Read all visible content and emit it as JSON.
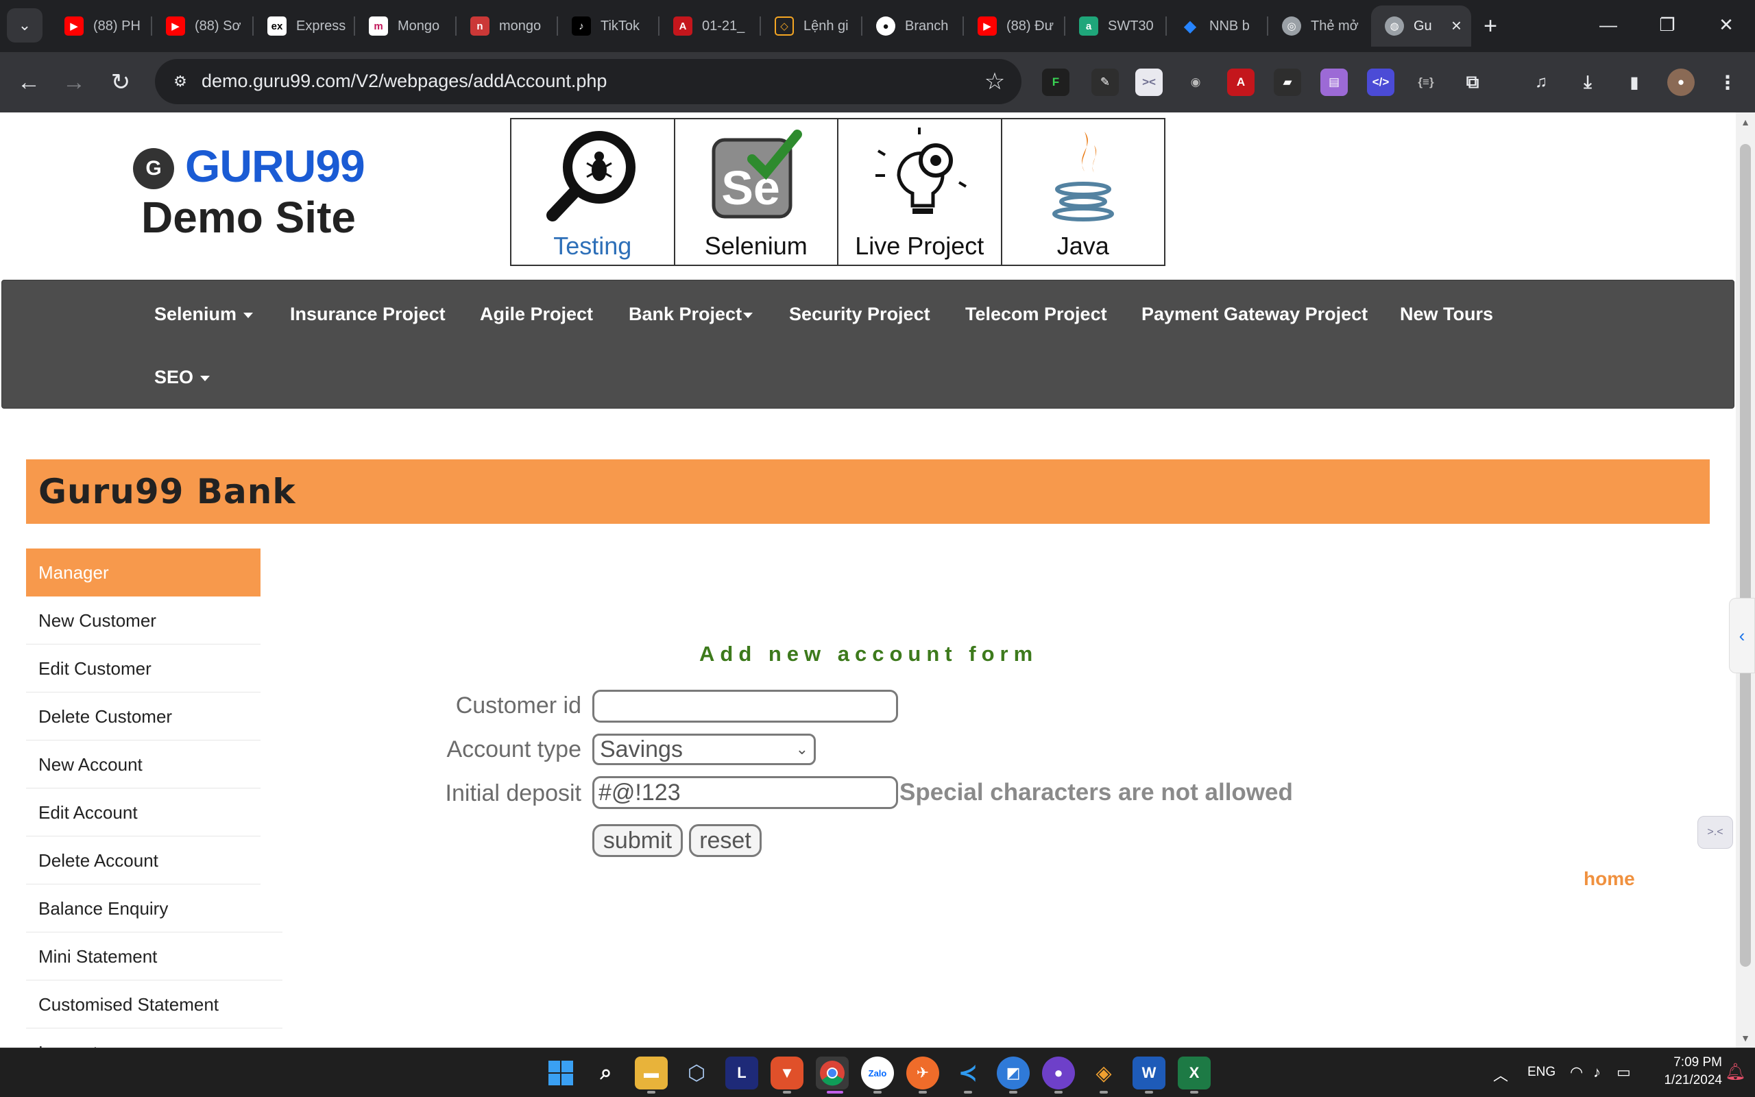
{
  "browser": {
    "tabs": [
      {
        "title": "(88) PH",
        "favicon": "youtube-icon",
        "color": "#ff0000"
      },
      {
        "title": "(88) Sơ",
        "favicon": "youtube-icon",
        "color": "#ff0000"
      },
      {
        "title": "Express",
        "favicon": "express-icon",
        "color": "#ffffff"
      },
      {
        "title": "Mongo",
        "favicon": "mongo-m-icon",
        "color": "#c2185b"
      },
      {
        "title": "mongo",
        "favicon": "npm-icon",
        "color": "#cb3837"
      },
      {
        "title": "TikTok",
        "favicon": "tiktok-icon",
        "color": "#000000"
      },
      {
        "title": "01-21_",
        "favicon": "pdf-icon",
        "color": "#c4161c"
      },
      {
        "title": "Lệnh gi",
        "favicon": "git-icon",
        "color": "#f5a623"
      },
      {
        "title": "Branch",
        "favicon": "github-icon",
        "color": "#ffffff"
      },
      {
        "title": "(88) Đư",
        "favicon": "youtube-icon",
        "color": "#ff0000"
      },
      {
        "title": "SWT30",
        "favicon": "a-icon",
        "color": "#1fa67a"
      },
      {
        "title": "NNB b",
        "favicon": "jira-icon",
        "color": "#2684ff"
      },
      {
        "title": "Thẻ mở",
        "favicon": "chrome-icon",
        "color": "#9aa0a6"
      },
      {
        "title": "Gu",
        "favicon": "globe-icon",
        "color": "#9aa0a6"
      }
    ],
    "url": "demo.guru99.com/V2/webpages/addAccount.php"
  },
  "site": {
    "logo_brand": "GURU99",
    "logo_sub": "Demo Site",
    "banner": [
      {
        "label": "Testing",
        "icon": "magnifier-bug-icon"
      },
      {
        "label": "Selenium",
        "icon": "selenium-icon"
      },
      {
        "label": "Live Project",
        "icon": "bulb-gear-icon"
      },
      {
        "label": "Java",
        "icon": "java-icon"
      }
    ],
    "nav": {
      "row1": [
        "Selenium",
        "Insurance Project",
        "Agile Project",
        "Bank Project",
        "Security Project",
        "Telecom Project",
        "Payment Gateway Project",
        "New Tours"
      ],
      "row2": [
        "SEO"
      ]
    }
  },
  "bank": {
    "title": "Guru99 Bank",
    "sidebar": [
      "Manager",
      "New Customer",
      "Edit Customer",
      "Delete Customer",
      "New Account",
      "Edit Account",
      "Delete Account",
      "Balance Enquiry",
      "Mini Statement",
      "Customised Statement",
      "Log out"
    ],
    "active_item": "Manager"
  },
  "form": {
    "title": "Add new account form",
    "customer_id_label": "Customer id",
    "customer_id_value": "",
    "account_type_label": "Account type",
    "account_type_value": "Savings",
    "initial_deposit_label": "Initial deposit",
    "initial_deposit_value": "#@!123",
    "deposit_error": "Special characters are not allowed",
    "submit_label": "submit",
    "reset_label": "reset",
    "home_link": "home"
  },
  "taskbar": {
    "language": "ENG",
    "time": "7:09 PM",
    "date": "1/21/2024"
  },
  "colors": {
    "accent_orange": "#f7994c",
    "nav_gray": "#4d4d4d",
    "form_title_green": "#3d7a1c"
  }
}
